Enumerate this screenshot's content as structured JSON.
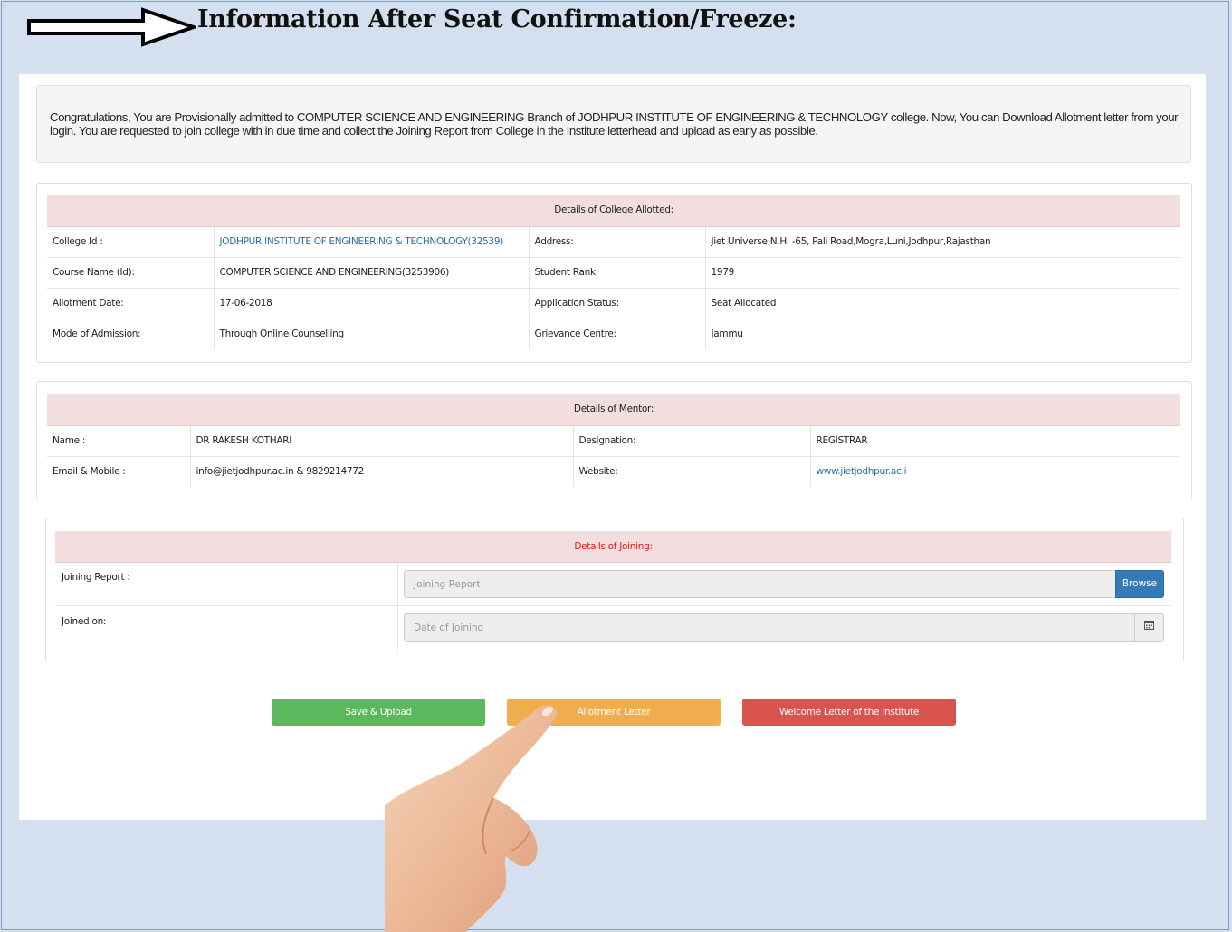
{
  "title": "Information After Seat Confirmation/Freeze:",
  "notice": {
    "line1": "Congratulations, You are Provisionally admitted to COMPUTER SCIENCE AND ENGINEERING Branch of JODHPUR INSTITUTE OF ENGINEERING & TECHNOLOGY college. Now, You can Download Allotment letter from your",
    "line2": "login. You are requested to join college with in due time and collect the Joining Report from College in the Institute letterhead and upload as early as possible."
  },
  "college": {
    "heading": "Details of College Allotted:",
    "rows": [
      {
        "l1": "College Id :",
        "v1": "JODHPUR INSTITUTE OF ENGINEERING & TECHNOLOGY(32539)",
        "l2": "Address:",
        "v2": "Jiet Universe,N.H. -65, Pali Road,Mogra,Luni,Jodhpur,Rajasthan"
      },
      {
        "l1": "Course Name (Id):",
        "v1": "COMPUTER SCIENCE AND ENGINEERING(3253906)",
        "l2": "Student Rank:",
        "v2": "1979"
      },
      {
        "l1": "Allotment Date:",
        "v1": "17-06-2018",
        "l2": "Application Status:",
        "v2": "Seat Allocated"
      },
      {
        "l1": "Mode of Admission:",
        "v1": "Through Online Counselling",
        "l2": "Grievance Centre:",
        "v2": "Jammu"
      }
    ]
  },
  "mentor": {
    "heading": "Details of Mentor:",
    "rows": [
      {
        "l1": "Name :",
        "v1": "DR RAKESH KOTHARI",
        "l2": "Designation:",
        "v2": "REGISTRAR"
      },
      {
        "l1": "Email & Mobile :",
        "v1": "info@jietjodhpur.ac.in & 9829214772",
        "l2": "Website:",
        "v2": "www.jietjodhpur.ac.i"
      }
    ]
  },
  "joining": {
    "heading": "Details of Joining:",
    "report_label": "Joining Report :",
    "report_placeholder": "Joining Report",
    "browse_label": "Browse",
    "joined_label": "Joined on:",
    "date_placeholder": "Date of Joining"
  },
  "buttons": {
    "save": "Save & Upload",
    "allotment": "Allotment Letter",
    "welcome": "Welcome Letter of the Institute"
  },
  "colors": {
    "background": "#d4e0ef",
    "header_row": "#f2dede",
    "save": "#5cb85c",
    "allotment": "#f0ad4e",
    "welcome": "#d9534f",
    "browse": "#337ab7",
    "link": "#2a6db0"
  },
  "icons": {
    "title_arrow": "right-arrow-icon",
    "calendar": "calendar-icon",
    "hand": "pointing-hand"
  }
}
